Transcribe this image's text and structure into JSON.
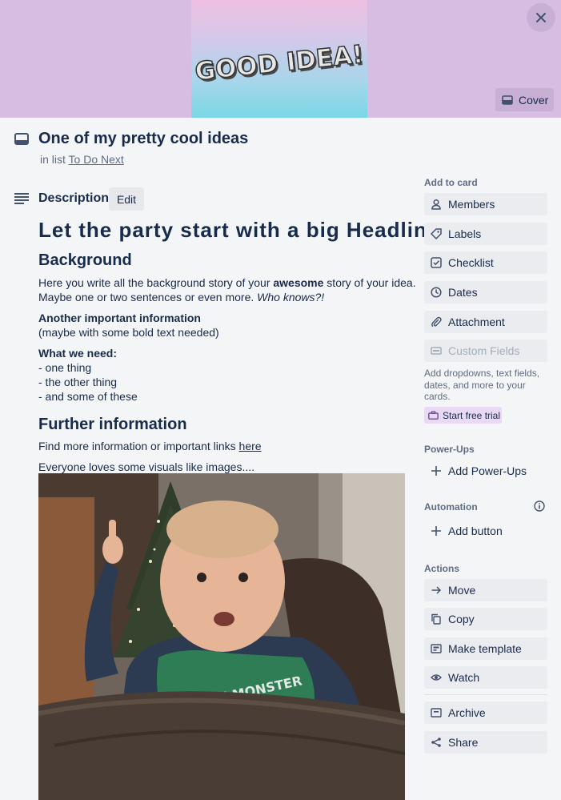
{
  "cover": {
    "art_text": "GOOD IDEA!",
    "cover_button_label": "Cover",
    "colors": {
      "background": "#d7bde1",
      "art_top": "#eebfe0",
      "art_bottom": "#79d7e6"
    }
  },
  "card": {
    "title": "One of my pretty cool ideas",
    "in_list_prefix": "in list",
    "list_name": "To Do Next"
  },
  "description": {
    "heading": "Description",
    "edit_label": "Edit",
    "headline": "Let the party start with a big Headline!",
    "background_heading": "Background",
    "background_p1_a": "Here you write all the background story of your ",
    "background_p1_bold": "awesome",
    "background_p1_b": " story of your idea.",
    "background_p2_a": "Maybe one or two sentences or even more. ",
    "background_p2_italic": "Who knows?!",
    "important_bold": "Another important information",
    "important_note": "(maybe with some bold text needed)",
    "need_bold": "What we need:",
    "need_items": [
      "- one thing",
      "- the other thing",
      "- and some of these"
    ],
    "further_heading": "Further information",
    "further_text": "Find more information or important links ",
    "further_link": "here",
    "visuals_text": "Everyone loves some visuals like images....",
    "image_caption_text": "LITTLE MONSTER"
  },
  "sidebar": {
    "add_to_card": "Add to card",
    "add_items": [
      {
        "label": "Members",
        "icon": "person-icon"
      },
      {
        "label": "Labels",
        "icon": "tag-icon"
      },
      {
        "label": "Checklist",
        "icon": "checkbox-icon"
      },
      {
        "label": "Dates",
        "icon": "clock-icon"
      },
      {
        "label": "Attachment",
        "icon": "paperclip-icon"
      },
      {
        "label": "Custom Fields",
        "icon": "custom-fields-icon"
      }
    ],
    "custom_fields_hint": "Add dropdowns, text fields, dates, and more to your cards.",
    "trial_label": "Start free trial",
    "power_ups_heading": "Power-Ups",
    "add_power_ups": "Add Power-Ups",
    "automation_heading": "Automation",
    "add_button": "Add button",
    "actions_heading": "Actions",
    "actions": [
      {
        "label": "Move",
        "icon": "arrow-right-icon"
      },
      {
        "label": "Copy",
        "icon": "copy-icon"
      },
      {
        "label": "Make template",
        "icon": "template-icon"
      },
      {
        "label": "Watch",
        "icon": "eye-icon"
      },
      {
        "label": "Archive",
        "icon": "archive-icon"
      },
      {
        "label": "Share",
        "icon": "share-icon"
      }
    ]
  }
}
